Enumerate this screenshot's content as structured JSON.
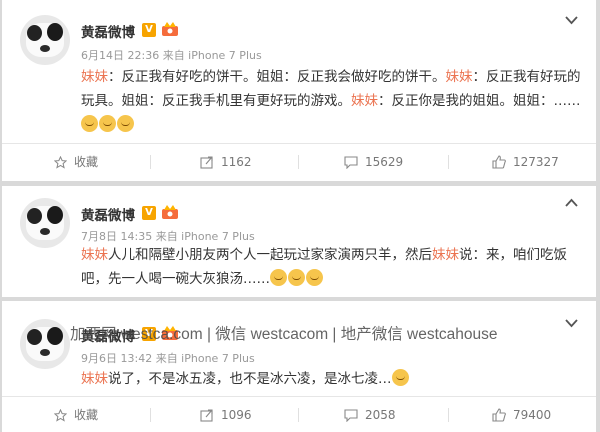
{
  "posts": [
    {
      "author": "黄磊微博",
      "verified_badge": "V",
      "meta": "6月14日 22:36 来自 iPhone 7 Plus",
      "segments": [
        {
          "t": "妹妹",
          "hl": true
        },
        {
          "t": "：反正我有好吃的饼干。姐姐：反正我会做好吃的饼干。",
          "hl": false
        },
        {
          "t": "妹妹",
          "hl": true
        },
        {
          "t": "：反正我有好玩的玩具。姐姐：反正我手机里有更好玩的游戏。",
          "hl": false
        },
        {
          "t": "妹妹",
          "hl": true
        },
        {
          "t": "：反正你是我的姐姐。姐姐：……",
          "hl": false
        }
      ],
      "emoji_count": 3,
      "favorite_label": "收藏",
      "reposts": "1162",
      "comments": "15629",
      "likes": "127327"
    },
    {
      "author": "黄磊微博",
      "verified_badge": "V",
      "meta": "7月8日 14:35 来自 iPhone 7 Plus",
      "segments": [
        {
          "t": "妹妹",
          "hl": true
        },
        {
          "t": "人儿和隔壁小朋友两个人一起玩过家家演两只羊，然后",
          "hl": false
        },
        {
          "t": "妹妹",
          "hl": true
        },
        {
          "t": "说：来，咱们吃饭吧，先一人喝一碗大灰狼汤……",
          "hl": false
        }
      ],
      "emoji_count": 3
    },
    {
      "author": "黄磊微博",
      "verified_badge": "V",
      "meta": "9月6日 13:42 来自 iPhone 7 Plus",
      "segments": [
        {
          "t": "妹妹",
          "hl": true
        },
        {
          "t": "说了，不是冰五凌，也不是冰六凌，是冰七凌…",
          "hl": false
        }
      ],
      "emoji_count": 1,
      "favorite_label": "收藏",
      "reposts": "1096",
      "comments": "2058",
      "likes": "79400"
    }
  ],
  "watermark": "加西网 westca.com | 微信 westcacom | 地产微信 westcahouse",
  "colors": {
    "highlight": "#eb7350",
    "badge": "#f7a400",
    "text": "#333333",
    "meta": "#999999"
  }
}
